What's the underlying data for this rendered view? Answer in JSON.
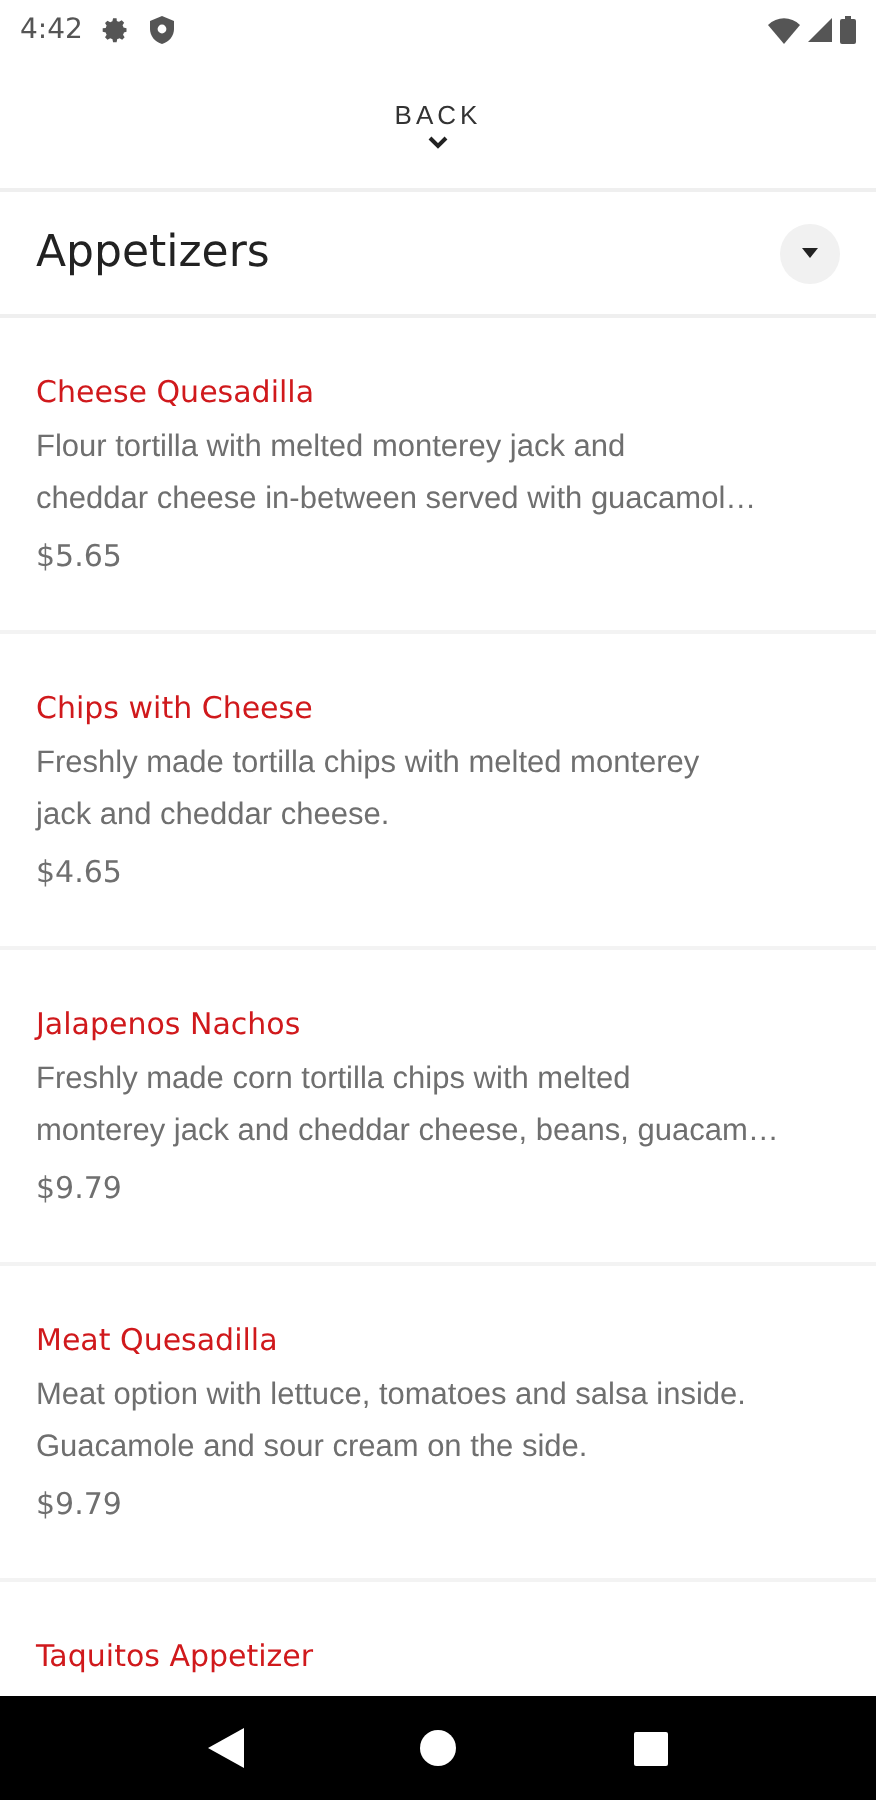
{
  "status_bar": {
    "time": "4:42"
  },
  "header": {
    "back_label": "BACK"
  },
  "category": {
    "title": "Appetizers",
    "expanded": true
  },
  "items": [
    {
      "name": "Cheese Quesadilla",
      "description": [
        "Flour tortilla with melted monterey jack and",
        "cheddar cheese in-between served with guacamol…"
      ],
      "price": "$5.65"
    },
    {
      "name": "Chips with Cheese",
      "description": [
        "Freshly made tortilla chips with melted monterey",
        "jack and cheddar cheese."
      ],
      "price": "$4.65"
    },
    {
      "name": "Jalapenos Nachos",
      "description": [
        "Freshly made corn tortilla chips with melted",
        "monterey jack and cheddar cheese, beans, guacam…"
      ],
      "price": "$9.79"
    },
    {
      "name": "Meat Quesadilla",
      "description": [
        "Meat option with lettuce, tomatoes and salsa inside.",
        "Guacamole and sour cream on the side."
      ],
      "price": "$9.79"
    },
    {
      "name": "Taquitos Appetizer"
    }
  ]
}
